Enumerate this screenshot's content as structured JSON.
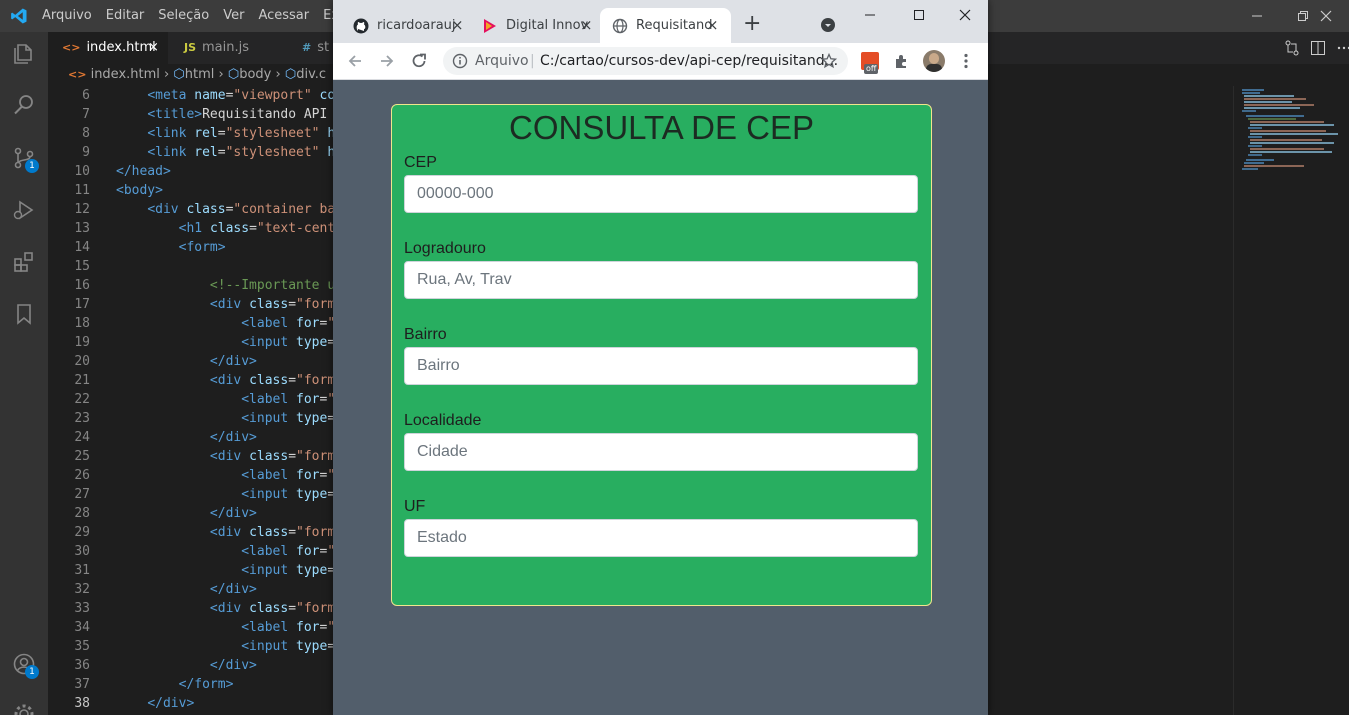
{
  "vscode": {
    "menu": [
      "Arquivo",
      "Editar",
      "Seleção",
      "Ver",
      "Acessar",
      "Exec"
    ],
    "tabs": [
      {
        "icon": "<>",
        "label": "index.html",
        "close": "×"
      },
      {
        "icon": "JS",
        "label": "main.js"
      },
      {
        "icon": "#",
        "label": "st"
      }
    ],
    "breadcrumb": {
      "file": "index.html",
      "items": [
        "html",
        "body",
        "div.c"
      ]
    },
    "badges": {
      "source_control": "1",
      "accounts": "1"
    },
    "code_lines": [
      {
        "n": "6",
        "parts": [
          [
            "t",
            "    "
          ],
          [
            "tag",
            "<meta"
          ],
          [
            "t",
            " "
          ],
          [
            "attr",
            "name"
          ],
          [
            "t",
            "="
          ],
          [
            "str",
            "\"viewport\""
          ],
          [
            "t",
            " "
          ],
          [
            "attr",
            "co"
          ]
        ]
      },
      {
        "n": "7",
        "parts": [
          [
            "t",
            "    "
          ],
          [
            "tag",
            "<title>"
          ],
          [
            "t",
            "Requisitando API V"
          ]
        ]
      },
      {
        "n": "8",
        "parts": [
          [
            "t",
            "    "
          ],
          [
            "tag",
            "<link"
          ],
          [
            "t",
            " "
          ],
          [
            "attr",
            "rel"
          ],
          [
            "t",
            "="
          ],
          [
            "str",
            "\"stylesheet\""
          ],
          [
            "t",
            " "
          ],
          [
            "attr",
            "hr"
          ]
        ]
      },
      {
        "n": "9",
        "parts": [
          [
            "t",
            "    "
          ],
          [
            "tag",
            "<link"
          ],
          [
            "t",
            " "
          ],
          [
            "attr",
            "rel"
          ],
          [
            "t",
            "="
          ],
          [
            "str",
            "\"stylesheet\""
          ],
          [
            "t",
            " "
          ],
          [
            "attr",
            "hr"
          ]
        ]
      },
      {
        "n": "10",
        "parts": [
          [
            "tag",
            "</head>"
          ]
        ]
      },
      {
        "n": "11",
        "parts": [
          [
            "tag",
            "<body>"
          ]
        ]
      },
      {
        "n": "12",
        "parts": [
          [
            "t",
            "    "
          ],
          [
            "tag",
            "<div"
          ],
          [
            "t",
            " "
          ],
          [
            "attr",
            "class"
          ],
          [
            "t",
            "="
          ],
          [
            "str",
            "\"container ba"
          ]
        ]
      },
      {
        "n": "13",
        "parts": [
          [
            "t",
            "        "
          ],
          [
            "tag",
            "<h1"
          ],
          [
            "t",
            " "
          ],
          [
            "attr",
            "class"
          ],
          [
            "t",
            "="
          ],
          [
            "str",
            "\"text-cente"
          ]
        ]
      },
      {
        "n": "14",
        "parts": [
          [
            "t",
            "        "
          ],
          [
            "tag",
            "<form>"
          ]
        ]
      },
      {
        "n": "15",
        "parts": [
          [
            "t",
            ""
          ]
        ]
      },
      {
        "n": "16",
        "parts": [
          [
            "t",
            "            "
          ],
          [
            "com",
            "<!--Importante u"
          ]
        ]
      },
      {
        "n": "17",
        "parts": [
          [
            "t",
            "            "
          ],
          [
            "tag",
            "<div"
          ],
          [
            "t",
            " "
          ],
          [
            "attr",
            "class"
          ],
          [
            "t",
            "="
          ],
          [
            "str",
            "\"form"
          ]
        ]
      },
      {
        "n": "18",
        "parts": [
          [
            "t",
            "                "
          ],
          [
            "tag",
            "<label"
          ],
          [
            "t",
            " "
          ],
          [
            "attr",
            "for"
          ],
          [
            "t",
            "="
          ],
          [
            "str",
            "\""
          ]
        ]
      },
      {
        "n": "19",
        "parts": [
          [
            "t",
            "                "
          ],
          [
            "tag",
            "<input"
          ],
          [
            "t",
            " "
          ],
          [
            "attr",
            "type"
          ],
          [
            "t",
            "="
          ]
        ]
      },
      {
        "n": "20",
        "parts": [
          [
            "t",
            "            "
          ],
          [
            "tag",
            "</div>"
          ]
        ]
      },
      {
        "n": "21",
        "parts": [
          [
            "t",
            "            "
          ],
          [
            "tag",
            "<div"
          ],
          [
            "t",
            " "
          ],
          [
            "attr",
            "class"
          ],
          [
            "t",
            "="
          ],
          [
            "str",
            "\"form"
          ]
        ]
      },
      {
        "n": "22",
        "parts": [
          [
            "t",
            "                "
          ],
          [
            "tag",
            "<label"
          ],
          [
            "t",
            " "
          ],
          [
            "attr",
            "for"
          ],
          [
            "t",
            "="
          ],
          [
            "str",
            "\""
          ]
        ]
      },
      {
        "n": "23",
        "parts": [
          [
            "t",
            "                "
          ],
          [
            "tag",
            "<input"
          ],
          [
            "t",
            " "
          ],
          [
            "attr",
            "type"
          ],
          [
            "t",
            "="
          ]
        ]
      },
      {
        "n": "24",
        "parts": [
          [
            "t",
            "            "
          ],
          [
            "tag",
            "</div>"
          ]
        ]
      },
      {
        "n": "25",
        "parts": [
          [
            "t",
            "            "
          ],
          [
            "tag",
            "<div"
          ],
          [
            "t",
            " "
          ],
          [
            "attr",
            "class"
          ],
          [
            "t",
            "="
          ],
          [
            "str",
            "\"form"
          ]
        ]
      },
      {
        "n": "26",
        "parts": [
          [
            "t",
            "                "
          ],
          [
            "tag",
            "<label"
          ],
          [
            "t",
            " "
          ],
          [
            "attr",
            "for"
          ],
          [
            "t",
            "="
          ],
          [
            "str",
            "\""
          ]
        ]
      },
      {
        "n": "27",
        "parts": [
          [
            "t",
            "                "
          ],
          [
            "tag",
            "<input"
          ],
          [
            "t",
            " "
          ],
          [
            "attr",
            "type"
          ],
          [
            "t",
            "="
          ]
        ]
      },
      {
        "n": "28",
        "parts": [
          [
            "t",
            "            "
          ],
          [
            "tag",
            "</div>"
          ]
        ]
      },
      {
        "n": "29",
        "parts": [
          [
            "t",
            "            "
          ],
          [
            "tag",
            "<div"
          ],
          [
            "t",
            " "
          ],
          [
            "attr",
            "class"
          ],
          [
            "t",
            "="
          ],
          [
            "str",
            "\"form"
          ]
        ]
      },
      {
        "n": "30",
        "parts": [
          [
            "t",
            "                "
          ],
          [
            "tag",
            "<label"
          ],
          [
            "t",
            " "
          ],
          [
            "attr",
            "for"
          ],
          [
            "t",
            "="
          ],
          [
            "str",
            "\""
          ]
        ]
      },
      {
        "n": "31",
        "parts": [
          [
            "t",
            "                "
          ],
          [
            "tag",
            "<input"
          ],
          [
            "t",
            " "
          ],
          [
            "attr",
            "type"
          ],
          [
            "t",
            "="
          ]
        ]
      },
      {
        "n": "32",
        "parts": [
          [
            "t",
            "            "
          ],
          [
            "tag",
            "</div>"
          ]
        ]
      },
      {
        "n": "33",
        "parts": [
          [
            "t",
            "            "
          ],
          [
            "tag",
            "<div"
          ],
          [
            "t",
            " "
          ],
          [
            "attr",
            "class"
          ],
          [
            "t",
            "="
          ],
          [
            "str",
            "\"form"
          ]
        ]
      },
      {
        "n": "34",
        "parts": [
          [
            "t",
            "                "
          ],
          [
            "tag",
            "<label"
          ],
          [
            "t",
            " "
          ],
          [
            "attr",
            "for"
          ],
          [
            "t",
            "="
          ],
          [
            "str",
            "\""
          ]
        ]
      },
      {
        "n": "35",
        "parts": [
          [
            "t",
            "                "
          ],
          [
            "tag",
            "<input"
          ],
          [
            "t",
            " "
          ],
          [
            "attr",
            "type"
          ],
          [
            "t",
            "="
          ]
        ]
      },
      {
        "n": "36",
        "parts": [
          [
            "t",
            "            "
          ],
          [
            "tag",
            "</div>"
          ]
        ]
      },
      {
        "n": "37",
        "parts": [
          [
            "t",
            "        "
          ],
          [
            "tag",
            "</form>"
          ]
        ]
      },
      {
        "n": "38",
        "parts": [
          [
            "t",
            "    "
          ],
          [
            "tag",
            "</div>"
          ]
        ]
      }
    ]
  },
  "chrome": {
    "tabs": [
      {
        "label": "ricardoarauj",
        "icon": "github-icon"
      },
      {
        "label": "Digital Innov",
        "icon": "dio-icon"
      },
      {
        "label": "Requisitand",
        "icon": "globe-icon"
      }
    ],
    "new_tab": "+",
    "address": {
      "scheme_label": "Arquivo",
      "url": "C:/cartao/cursos-dev/api-cep/requisitand..."
    },
    "extension_badge": "off"
  },
  "page": {
    "title": "CONSULTA DE CEP",
    "fields": [
      {
        "label": "CEP",
        "placeholder": "00000-000"
      },
      {
        "label": "Logradouro",
        "placeholder": "Rua, Av, Trav"
      },
      {
        "label": "Bairro",
        "placeholder": "Bairro"
      },
      {
        "label": "Localidade",
        "placeholder": "Cidade"
      },
      {
        "label": "UF",
        "placeholder": "Estado"
      }
    ]
  },
  "colors": {
    "card_bg": "#28ae60",
    "card_border": "#f0e68c",
    "page_bg": "#525e6b",
    "vscode_accent": "#007acc"
  }
}
